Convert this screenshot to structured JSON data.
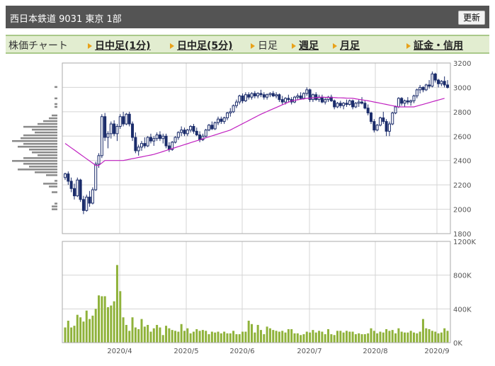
{
  "header": {
    "title": "西日本鉄道  9031  東京 1部",
    "refresh_label": "更新"
  },
  "tabs": [
    {
      "label": "株価チャート",
      "link": false,
      "arrow": false
    },
    {
      "label": "日中足(1分)",
      "link": true,
      "arrow": true
    },
    {
      "label": "日中足(5分)",
      "link": true,
      "arrow": true
    },
    {
      "label": "日足",
      "link": false,
      "arrow": true
    },
    {
      "label": "週足",
      "link": true,
      "arrow": true
    },
    {
      "label": "月足",
      "link": true,
      "arrow": true
    },
    {
      "label": "証金・信用",
      "link": true,
      "arrow": true
    }
  ],
  "colors": {
    "candle": "#1b2c6b",
    "ma": "#c020c0",
    "volume": "#8fb23a",
    "profile": "#8a8a8a",
    "grid": "#d4d4d4",
    "frame": "#aaaaaa",
    "axis_text": "#555555"
  },
  "chart_data": [
    {
      "type": "candlestick",
      "title": "",
      "y_ticks": [
        "3200",
        "3000",
        "2800",
        "2600",
        "2400",
        "2200",
        "2000",
        "1800"
      ],
      "ylim": [
        1800,
        3200
      ],
      "x_ticks": [
        "2020/4",
        "2020/5",
        "2020/6",
        "2020/7",
        "2020/8",
        "2020/9"
      ],
      "candles": [
        [
          2260,
          2300,
          2240,
          2290
        ],
        [
          2290,
          2310,
          2200,
          2230
        ],
        [
          2230,
          2260,
          2140,
          2170
        ],
        [
          2170,
          2210,
          2080,
          2110
        ],
        [
          2110,
          2260,
          2100,
          2240
        ],
        [
          2240,
          2250,
          2060,
          2080
        ],
        [
          2080,
          2110,
          1960,
          1990
        ],
        [
          1990,
          2120,
          1980,
          2100
        ],
        [
          2100,
          2150,
          2020,
          2050
        ],
        [
          2050,
          2180,
          2040,
          2160
        ],
        [
          2160,
          2390,
          2150,
          2370
        ],
        [
          2370,
          2460,
          2340,
          2440
        ],
        [
          2440,
          2780,
          2420,
          2760
        ],
        [
          2760,
          2790,
          2560,
          2590
        ],
        [
          2590,
          2640,
          2500,
          2620
        ],
        [
          2620,
          2720,
          2580,
          2700
        ],
        [
          2700,
          2730,
          2600,
          2620
        ],
        [
          2620,
          2700,
          2560,
          2680
        ],
        [
          2680,
          2780,
          2660,
          2760
        ],
        [
          2760,
          2800,
          2680,
          2700
        ],
        [
          2700,
          2790,
          2690,
          2780
        ],
        [
          2780,
          2800,
          2680,
          2700
        ],
        [
          2700,
          2720,
          2560,
          2590
        ],
        [
          2590,
          2630,
          2460,
          2480
        ],
        [
          2480,
          2530,
          2440,
          2510
        ],
        [
          2510,
          2560,
          2480,
          2540
        ],
        [
          2540,
          2590,
          2500,
          2520
        ],
        [
          2520,
          2600,
          2510,
          2590
        ],
        [
          2590,
          2620,
          2540,
          2560
        ],
        [
          2560,
          2600,
          2520,
          2580
        ],
        [
          2580,
          2630,
          2560,
          2610
        ],
        [
          2610,
          2640,
          2560,
          2580
        ],
        [
          2580,
          2620,
          2540,
          2600
        ],
        [
          2600,
          2620,
          2500,
          2520
        ],
        [
          2520,
          2550,
          2470,
          2490
        ],
        [
          2490,
          2560,
          2480,
          2550
        ],
        [
          2550,
          2600,
          2540,
          2590
        ],
        [
          2590,
          2640,
          2570,
          2630
        ],
        [
          2630,
          2680,
          2600,
          2650
        ],
        [
          2650,
          2670,
          2600,
          2620
        ],
        [
          2620,
          2660,
          2600,
          2650
        ],
        [
          2650,
          2690,
          2630,
          2680
        ],
        [
          2680,
          2700,
          2620,
          2640
        ],
        [
          2640,
          2670,
          2600,
          2610
        ],
        [
          2610,
          2640,
          2550,
          2570
        ],
        [
          2570,
          2620,
          2560,
          2600
        ],
        [
          2600,
          2660,
          2590,
          2650
        ],
        [
          2650,
          2700,
          2640,
          2690
        ],
        [
          2690,
          2720,
          2650,
          2660
        ],
        [
          2660,
          2720,
          2650,
          2710
        ],
        [
          2710,
          2760,
          2690,
          2740
        ],
        [
          2740,
          2760,
          2700,
          2720
        ],
        [
          2720,
          2760,
          2700,
          2750
        ],
        [
          2750,
          2800,
          2730,
          2790
        ],
        [
          2790,
          2830,
          2760,
          2800
        ],
        [
          2800,
          2860,
          2790,
          2850
        ],
        [
          2850,
          2900,
          2830,
          2880
        ],
        [
          2880,
          2940,
          2860,
          2930
        ],
        [
          2930,
          2950,
          2870,
          2890
        ],
        [
          2890,
          2960,
          2880,
          2940
        ],
        [
          2940,
          2960,
          2900,
          2920
        ],
        [
          2920,
          2960,
          2900,
          2950
        ],
        [
          2950,
          2970,
          2910,
          2930
        ],
        [
          2930,
          2960,
          2910,
          2950
        ],
        [
          2950,
          2980,
          2920,
          2940
        ],
        [
          2940,
          2960,
          2900,
          2920
        ],
        [
          2920,
          2950,
          2900,
          2940
        ],
        [
          2940,
          2960,
          2920,
          2950
        ],
        [
          2950,
          2970,
          2920,
          2930
        ],
        [
          2930,
          2960,
          2910,
          2940
        ],
        [
          2940,
          2950,
          2880,
          2900
        ],
        [
          2900,
          2930,
          2860,
          2880
        ],
        [
          2880,
          2920,
          2860,
          2910
        ],
        [
          2910,
          2940,
          2880,
          2900
        ],
        [
          2900,
          2920,
          2860,
          2880
        ],
        [
          2880,
          2930,
          2870,
          2920
        ],
        [
          2920,
          2950,
          2900,
          2930
        ],
        [
          2930,
          2960,
          2900,
          2910
        ],
        [
          2910,
          2960,
          2900,
          2950
        ],
        [
          2950,
          3000,
          2930,
          2980
        ],
        [
          2980,
          2990,
          2880,
          2900
        ],
        [
          2900,
          2950,
          2880,
          2940
        ],
        [
          2940,
          2960,
          2890,
          2900
        ],
        [
          2900,
          2940,
          2880,
          2920
        ],
        [
          2920,
          2940,
          2870,
          2880
        ],
        [
          2880,
          2920,
          2860,
          2900
        ],
        [
          2900,
          2930,
          2880,
          2920
        ],
        [
          2920,
          2940,
          2880,
          2890
        ],
        [
          2890,
          2900,
          2820,
          2840
        ],
        [
          2840,
          2880,
          2830,
          2870
        ],
        [
          2870,
          2890,
          2830,
          2850
        ],
        [
          2850,
          2880,
          2820,
          2870
        ],
        [
          2870,
          2900,
          2840,
          2860
        ],
        [
          2860,
          2900,
          2850,
          2890
        ],
        [
          2890,
          2900,
          2820,
          2840
        ],
        [
          2840,
          2880,
          2830,
          2870
        ],
        [
          2870,
          2900,
          2840,
          2880
        ],
        [
          2880,
          2920,
          2860,
          2870
        ],
        [
          2870,
          2890,
          2820,
          2830
        ],
        [
          2830,
          2860,
          2770,
          2790
        ],
        [
          2790,
          2800,
          2700,
          2720
        ],
        [
          2720,
          2740,
          2630,
          2650
        ],
        [
          2650,
          2700,
          2640,
          2690
        ],
        [
          2690,
          2760,
          2680,
          2750
        ],
        [
          2750,
          2800,
          2700,
          2720
        ],
        [
          2720,
          2740,
          2600,
          2640
        ],
        [
          2640,
          2720,
          2600,
          2700
        ],
        [
          2700,
          2800,
          2690,
          2790
        ],
        [
          2790,
          2850,
          2780,
          2840
        ],
        [
          2840,
          2920,
          2830,
          2910
        ],
        [
          2910,
          2920,
          2850,
          2870
        ],
        [
          2870,
          2900,
          2840,
          2890
        ],
        [
          2890,
          2920,
          2860,
          2880
        ],
        [
          2880,
          2900,
          2850,
          2890
        ],
        [
          2890,
          2940,
          2870,
          2930
        ],
        [
          2930,
          2990,
          2910,
          2980
        ],
        [
          2980,
          3020,
          2950,
          3000
        ],
        [
          3000,
          3010,
          2960,
          2980
        ],
        [
          2980,
          3030,
          2970,
          3020
        ],
        [
          3020,
          3060,
          2990,
          3010
        ],
        [
          3010,
          3130,
          3000,
          3110
        ],
        [
          3110,
          3120,
          3040,
          3060
        ],
        [
          3060,
          3070,
          3000,
          3030
        ],
        [
          3030,
          3060,
          3010,
          3050
        ],
        [
          3050,
          3090,
          3000,
          3020
        ],
        [
          3020,
          3060,
          2990,
          3000
        ]
      ],
      "moving_average": [
        2540,
        2522,
        2504,
        2486,
        2468,
        2450,
        2432,
        2414,
        2396,
        2378,
        2360,
        2360,
        2380,
        2400,
        2400,
        2400,
        2400,
        2400,
        2400,
        2400,
        2405,
        2410,
        2415,
        2420,
        2425,
        2430,
        2435,
        2440,
        2445,
        2450,
        2458,
        2466,
        2474,
        2482,
        2490,
        2498,
        2506,
        2514,
        2522,
        2530,
        2538,
        2546,
        2554,
        2562,
        2570,
        2578,
        2586,
        2594,
        2602,
        2610,
        2618,
        2626,
        2634,
        2642,
        2650,
        2663,
        2676,
        2689,
        2702,
        2715,
        2728,
        2741,
        2754,
        2767,
        2780,
        2791,
        2802,
        2813,
        2824,
        2835,
        2846,
        2857,
        2868,
        2879,
        2890,
        2894,
        2898,
        2902,
        2906,
        2910,
        2912,
        2914,
        2916,
        2918,
        2920,
        2919,
        2918,
        2917,
        2916,
        2915,
        2914,
        2913,
        2912,
        2911,
        2910,
        2906,
        2902,
        2898,
        2894,
        2890,
        2885,
        2880,
        2875,
        2870,
        2865,
        2860,
        2855,
        2850,
        2845,
        2840,
        2840,
        2840,
        2840,
        2840,
        2840,
        2847,
        2854,
        2861,
        2868,
        2875,
        2882,
        2889,
        2896,
        2903,
        2910
      ],
      "price_profile": [
        0,
        0,
        0,
        0,
        0,
        0,
        0,
        0,
        1,
        0,
        0,
        0,
        1,
        0,
        1,
        1,
        0,
        0,
        2,
        3,
        5,
        7,
        12,
        9,
        8,
        12,
        13,
        16,
        12,
        14,
        10,
        9,
        7,
        12,
        16,
        12,
        10,
        14,
        8,
        4,
        0,
        1,
        5,
        3,
        0,
        2,
        0,
        0,
        0,
        1,
        2,
        2,
        0,
        0,
        0,
        0,
        0,
        0,
        0,
        0
      ]
    },
    {
      "type": "bar",
      "title": "",
      "y_ticks": [
        "1200K",
        "800K",
        "400K",
        "0K"
      ],
      "ylim": [
        0,
        1200000
      ],
      "x_ticks": [
        "2020/4",
        "2020/5",
        "2020/6",
        "2020/7",
        "2020/8",
        "2020/9"
      ],
      "values": [
        180000,
        260000,
        180000,
        200000,
        330000,
        300000,
        250000,
        380000,
        280000,
        320000,
        400000,
        560000,
        550000,
        550000,
        420000,
        440000,
        490000,
        920000,
        610000,
        300000,
        210000,
        140000,
        300000,
        180000,
        160000,
        280000,
        190000,
        210000,
        130000,
        170000,
        210000,
        180000,
        90000,
        200000,
        170000,
        150000,
        140000,
        130000,
        220000,
        140000,
        170000,
        110000,
        130000,
        160000,
        140000,
        150000,
        140000,
        100000,
        130000,
        120000,
        130000,
        110000,
        130000,
        110000,
        110000,
        140000,
        100000,
        100000,
        130000,
        130000,
        260000,
        220000,
        120000,
        210000,
        150000,
        100000,
        190000,
        170000,
        150000,
        140000,
        130000,
        140000,
        120000,
        160000,
        160000,
        110000,
        110000,
        90000,
        100000,
        130000,
        120000,
        150000,
        120000,
        140000,
        130000,
        100000,
        160000,
        100000,
        90000,
        140000,
        140000,
        120000,
        140000,
        130000,
        130000,
        100000,
        110000,
        100000,
        100000,
        110000,
        170000,
        140000,
        110000,
        130000,
        120000,
        160000,
        140000,
        150000,
        110000,
        170000,
        130000,
        120000,
        120000,
        140000,
        120000,
        110000,
        130000,
        280000,
        170000,
        160000,
        140000,
        130000,
        110000,
        120000,
        170000,
        140000
      ]
    }
  ]
}
